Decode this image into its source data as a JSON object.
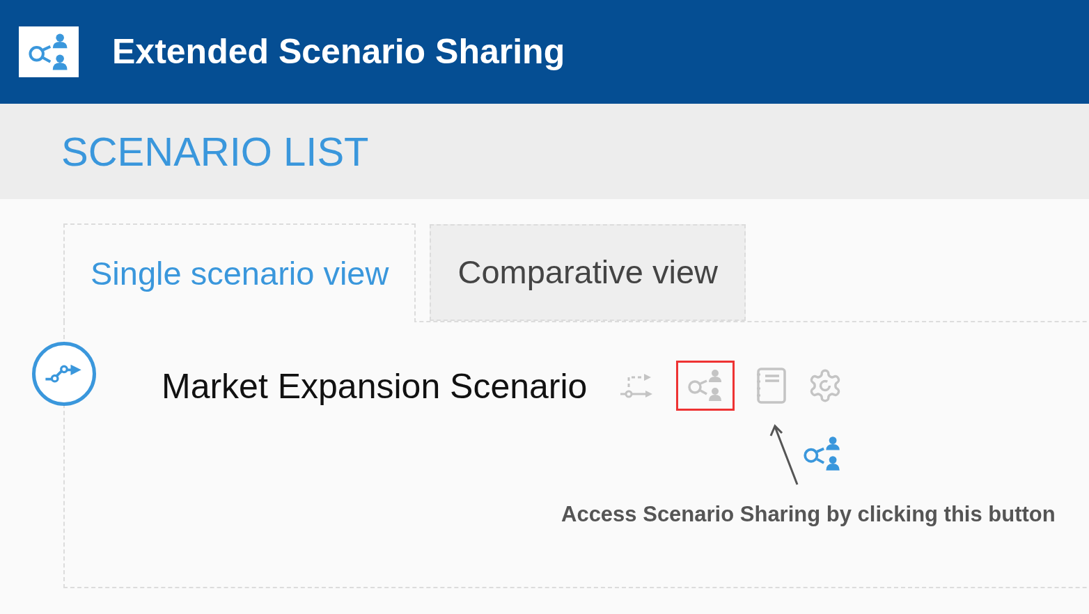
{
  "header": {
    "title": "Extended Scenario Sharing"
  },
  "section_title": "SCENARIO LIST",
  "tabs": [
    {
      "label": "Single scenario view",
      "selected": true
    },
    {
      "label": "Comparative view",
      "selected": false
    }
  ],
  "scenario": {
    "title": "Market Expansion Scenario",
    "actions": [
      {
        "kind": "compare",
        "highlighted": false
      },
      {
        "kind": "share",
        "highlighted": true
      },
      {
        "kind": "notes",
        "highlighted": false
      },
      {
        "kind": "settings",
        "highlighted": false
      }
    ]
  },
  "annotation": {
    "caption": "Access Scenario Sharing by clicking this button"
  }
}
